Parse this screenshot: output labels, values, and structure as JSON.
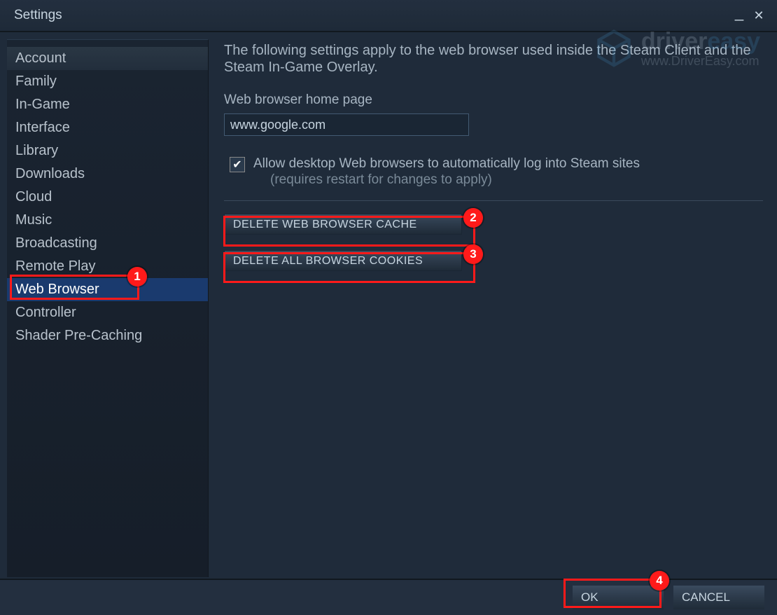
{
  "window": {
    "title": "Settings"
  },
  "sidebar": {
    "items": [
      {
        "label": "Account",
        "selected": false
      },
      {
        "label": "Family",
        "selected": false
      },
      {
        "label": "In-Game",
        "selected": false
      },
      {
        "label": "Interface",
        "selected": false
      },
      {
        "label": "Library",
        "selected": false
      },
      {
        "label": "Downloads",
        "selected": false
      },
      {
        "label": "Cloud",
        "selected": false
      },
      {
        "label": "Music",
        "selected": false
      },
      {
        "label": "Broadcasting",
        "selected": false
      },
      {
        "label": "Remote Play",
        "selected": false
      },
      {
        "label": "Web Browser",
        "selected": true
      },
      {
        "label": "Controller",
        "selected": false
      },
      {
        "label": "Shader Pre-Caching",
        "selected": false
      }
    ]
  },
  "main": {
    "description": "The following settings apply to the web browser used inside the Steam Client and the Steam In-Game Overlay.",
    "homepage_label": "Web browser home page",
    "homepage_value": "www.google.com",
    "checkbox_checked": true,
    "checkbox_label": "Allow desktop Web browsers to automatically log into Steam sites",
    "checkbox_sub": "(requires restart for changes to apply)",
    "button_delete_cache": "DELETE WEB BROWSER CACHE",
    "button_delete_cookies": "DELETE ALL BROWSER COOKIES"
  },
  "footer": {
    "ok": "OK",
    "cancel": "CANCEL"
  },
  "annotations": {
    "1": "1",
    "2": "2",
    "3": "3",
    "4": "4"
  },
  "watermark": {
    "brand_prefix": "driver",
    "brand_suffix": "easy",
    "url": "www.DriverEasy.com"
  }
}
